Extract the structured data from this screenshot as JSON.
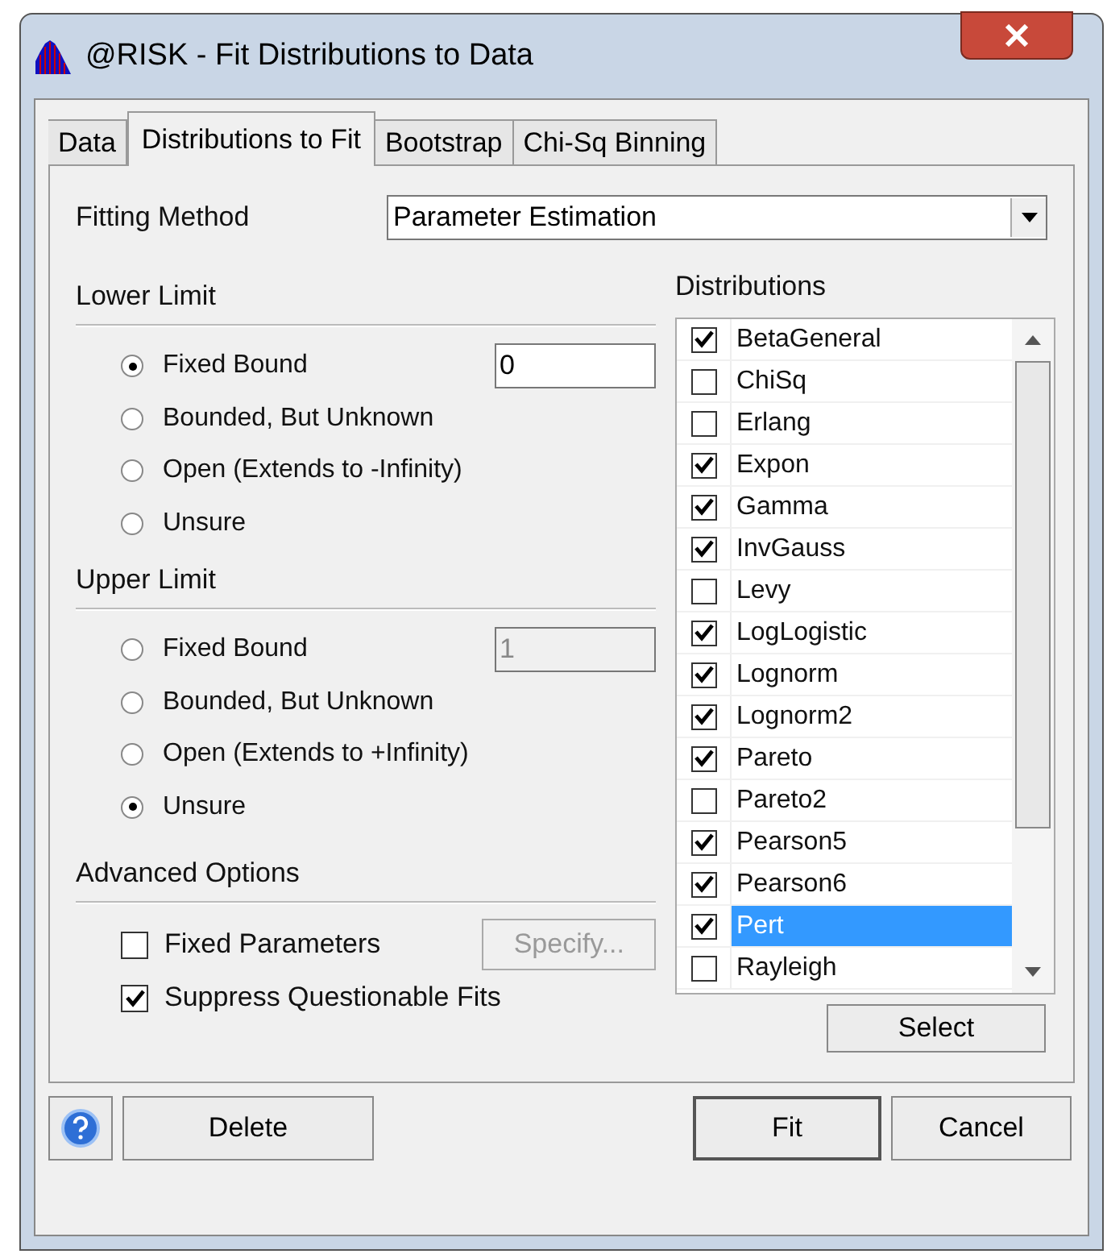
{
  "window": {
    "title": "@RISK - Fit Distributions to Data"
  },
  "tabs": [
    {
      "label": "Data",
      "selected": false
    },
    {
      "label": "Distributions to Fit",
      "selected": true
    },
    {
      "label": "Bootstrap",
      "selected": false
    },
    {
      "label": "Chi-Sq Binning",
      "selected": false
    }
  ],
  "fitting_method": {
    "label": "Fitting Method",
    "value": "Parameter Estimation"
  },
  "lower_limit": {
    "title": "Lower Limit",
    "bound_value": "0",
    "bound_disabled": false,
    "options": [
      {
        "label": "Fixed Bound",
        "selected": true
      },
      {
        "label": "Bounded, But Unknown",
        "selected": false
      },
      {
        "label": "Open (Extends to -Infinity)",
        "selected": false
      },
      {
        "label": "Unsure",
        "selected": false
      }
    ]
  },
  "upper_limit": {
    "title": "Upper Limit",
    "bound_value": "1",
    "bound_disabled": true,
    "options": [
      {
        "label": "Fixed Bound",
        "selected": false
      },
      {
        "label": "Bounded, But Unknown",
        "selected": false
      },
      {
        "label": "Open (Extends to +Infinity)",
        "selected": false
      },
      {
        "label": "Unsure",
        "selected": true
      }
    ]
  },
  "advanced_options": {
    "title": "Advanced Options",
    "fixed_parameters": {
      "label": "Fixed Parameters",
      "checked": false
    },
    "specify_button": {
      "label": "Specify...",
      "disabled": true
    },
    "suppress": {
      "label": "Suppress Questionable Fits",
      "checked": true
    }
  },
  "distributions": {
    "title": "Distributions",
    "items": [
      {
        "name": "BetaGeneral",
        "checked": true,
        "selected": false
      },
      {
        "name": "ChiSq",
        "checked": false,
        "selected": false
      },
      {
        "name": "Erlang",
        "checked": false,
        "selected": false
      },
      {
        "name": "Expon",
        "checked": true,
        "selected": false
      },
      {
        "name": "Gamma",
        "checked": true,
        "selected": false
      },
      {
        "name": "InvGauss",
        "checked": true,
        "selected": false
      },
      {
        "name": "Levy",
        "checked": false,
        "selected": false
      },
      {
        "name": "LogLogistic",
        "checked": true,
        "selected": false
      },
      {
        "name": "Lognorm",
        "checked": true,
        "selected": false
      },
      {
        "name": "Lognorm2",
        "checked": true,
        "selected": false
      },
      {
        "name": "Pareto",
        "checked": true,
        "selected": false
      },
      {
        "name": "Pareto2",
        "checked": false,
        "selected": false
      },
      {
        "name": "Pearson5",
        "checked": true,
        "selected": false
      },
      {
        "name": "Pearson6",
        "checked": true,
        "selected": false
      },
      {
        "name": "Pert",
        "checked": true,
        "selected": true
      },
      {
        "name": "Rayleigh",
        "checked": false,
        "selected": false
      }
    ],
    "select_button": "Select"
  },
  "buttons": {
    "delete": "Delete",
    "fit": "Fit",
    "cancel": "Cancel"
  }
}
